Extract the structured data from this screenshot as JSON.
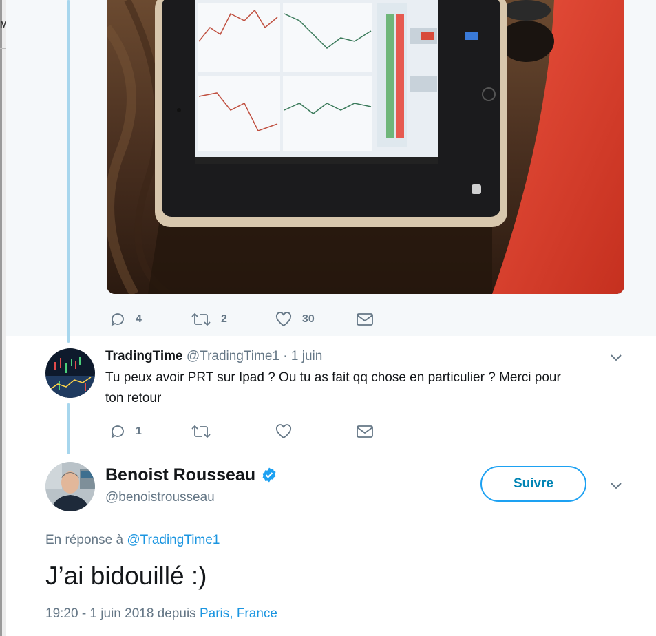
{
  "top_tweet": {
    "stats": {
      "replies": "4",
      "retweets": "2",
      "likes": "30"
    }
  },
  "reply": {
    "display_name": "TradingTime",
    "handle": "@TradingTime1",
    "separator": "·",
    "date": "1 juin",
    "text_line1": "Tu peux avoir PRT sur Ipad ? Ou tu as fait qq chose en particulier ? Merci pour",
    "text_line2": "ton retour",
    "stats": {
      "replies": "1",
      "retweets": "",
      "likes": ""
    }
  },
  "main_tweet": {
    "display_name": "Benoist Rousseau",
    "handle": "@benoistrousseau",
    "follow_label": "Suivre",
    "reply_prefix": "En réponse à",
    "reply_to": "@TradingTime1",
    "text": "J’ai bidouillé :)",
    "timestamp": "19:20 - 1 juin 2018 depuis",
    "location_city": "Paris",
    "location_sep": ",",
    "location_country": "France"
  },
  "colors": {
    "accent": "#1da1f2",
    "thread_line": "#a7d6ed",
    "muted": "#657786",
    "follow_border": "#1da1f2",
    "follow_text": "#0084b4"
  },
  "icons": [
    "reply-icon",
    "retweet-icon",
    "like-icon",
    "direct-message-icon",
    "chevron-down-icon",
    "verified-badge-icon"
  ]
}
